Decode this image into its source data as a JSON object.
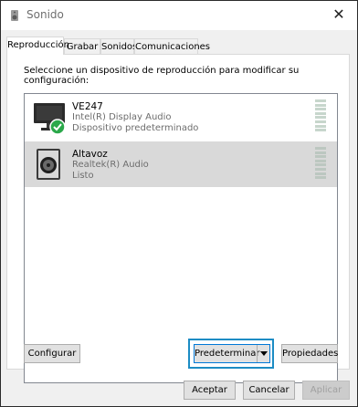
{
  "window": {
    "title": "Sonido",
    "close_glyph": "✕"
  },
  "tabs": [
    {
      "label": "Reproducción",
      "active": true
    },
    {
      "label": "Grabar"
    },
    {
      "label": "Sonidos"
    },
    {
      "label": "Comunicaciones"
    }
  ],
  "playback": {
    "instruction": "Seleccione un dispositivo de reproducción para modificar su configuración:",
    "devices": [
      {
        "name": "VE247",
        "line1": "Intel(R) Display Audio",
        "line2": "Dispositivo predeterminado",
        "icon": "monitor-icon",
        "badge": "default-check-icon",
        "selected": false
      },
      {
        "name": "Altavoz",
        "line1": "Realtek(R) Audio",
        "line2": "Listo",
        "icon": "speaker-icon",
        "selected": true
      }
    ]
  },
  "buttons": {
    "configure": "Configurar",
    "set_default": "Predeterminar",
    "properties": "Propiedades",
    "ok": "Aceptar",
    "cancel": "Cancelar",
    "apply": "Aplicar"
  },
  "colors": {
    "accent": "#0078d7",
    "highlight_box": "#1c8cc4",
    "default_check": "#2aa84a",
    "selected_row": "#d9d9d9"
  }
}
